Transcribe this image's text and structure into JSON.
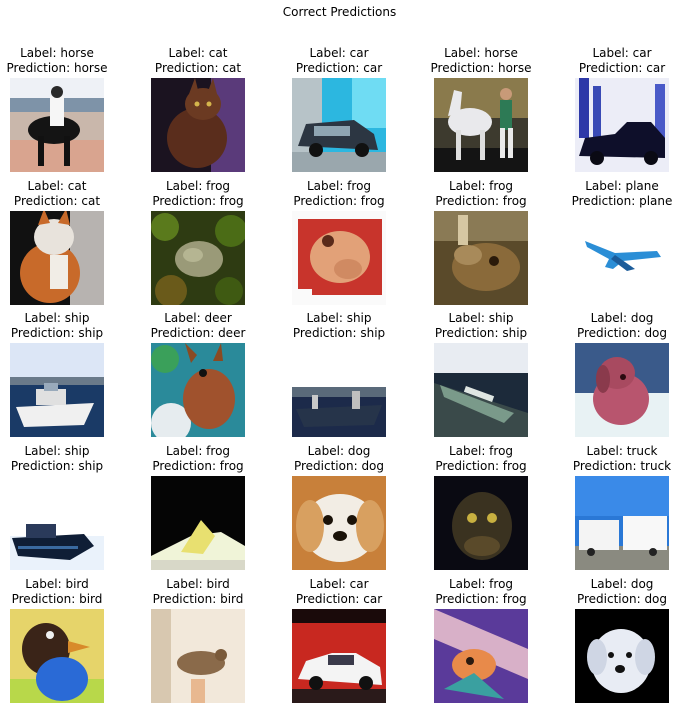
{
  "title": "Correct Predictions",
  "label_prefix": "Label:",
  "prediction_prefix": "Prediction:",
  "rows": [
    [
      {
        "label": "horse",
        "prediction": "horse",
        "scene": "horse-rider"
      },
      {
        "label": "cat",
        "prediction": "cat",
        "scene": "cat-dark"
      },
      {
        "label": "car",
        "prediction": "car",
        "scene": "car-cyan"
      },
      {
        "label": "horse",
        "prediction": "horse",
        "scene": "horse-white"
      },
      {
        "label": "car",
        "prediction": "car",
        "scene": "car-city"
      }
    ],
    [
      {
        "label": "cat",
        "prediction": "cat",
        "scene": "cat-orange"
      },
      {
        "label": "frog",
        "prediction": "frog",
        "scene": "frog-leaves"
      },
      {
        "label": "frog",
        "prediction": "frog",
        "scene": "frog-red"
      },
      {
        "label": "frog",
        "prediction": "frog",
        "scene": "frog-brown"
      },
      {
        "label": "plane",
        "prediction": "plane",
        "scene": "plane-white"
      }
    ],
    [
      {
        "label": "ship",
        "prediction": "ship",
        "scene": "ship-boat"
      },
      {
        "label": "deer",
        "prediction": "deer",
        "scene": "deer-green"
      },
      {
        "label": "ship",
        "prediction": "ship",
        "scene": "ship-pier"
      },
      {
        "label": "ship",
        "prediction": "ship",
        "scene": "ship-harbor"
      },
      {
        "label": "dog",
        "prediction": "dog",
        "scene": "dog-pink"
      }
    ],
    [
      {
        "label": "ship",
        "prediction": "ship",
        "scene": "ship-dark"
      },
      {
        "label": "frog",
        "prediction": "frog",
        "scene": "frog-black"
      },
      {
        "label": "dog",
        "prediction": "dog",
        "scene": "dog-face"
      },
      {
        "label": "frog",
        "prediction": "frog",
        "scene": "frog-night"
      },
      {
        "label": "truck",
        "prediction": "truck",
        "scene": "truck-sky"
      }
    ],
    [
      {
        "label": "bird",
        "prediction": "bird",
        "scene": "bird-colorful"
      },
      {
        "label": "bird",
        "prediction": "bird",
        "scene": "bird-beige"
      },
      {
        "label": "car",
        "prediction": "car",
        "scene": "car-red"
      },
      {
        "label": "frog",
        "prediction": "frog",
        "scene": "frog-purple"
      },
      {
        "label": "dog",
        "prediction": "dog",
        "scene": "dog-white"
      }
    ]
  ]
}
